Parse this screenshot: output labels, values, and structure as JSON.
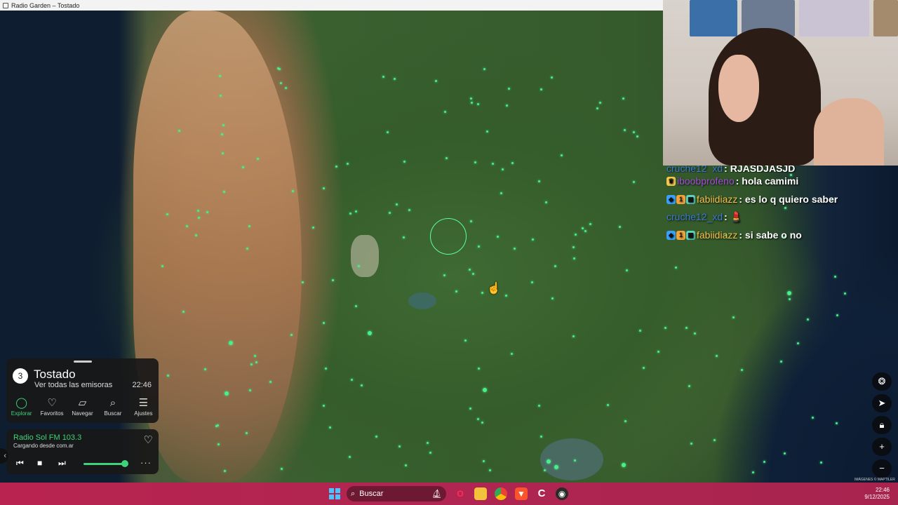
{
  "window": {
    "title": "Radio Garden – Tostado"
  },
  "chat": [
    {
      "user": "cruche12_xd",
      "message": ": RJASDJASJD",
      "user_color": "#3a7bd5",
      "badges": [],
      "cut": true
    },
    {
      "user": "iboobprofeno",
      "message": ": hola camimi",
      "user_color": "#a34bd9",
      "badges": [
        "crown"
      ]
    },
    {
      "user": "fabiidiazz",
      "message": ": es lo q quiero saber",
      "user_color": "#f5c24c",
      "badges": [
        "cube",
        "one",
        "grid"
      ]
    },
    {
      "user": "cruche12_xd",
      "message": ": 💄",
      "user_color": "#3a7bd5",
      "badges": []
    },
    {
      "user": "fabiidiazz",
      "message": ": si sabe o no",
      "user_color": "#f5c24c",
      "badges": [
        "cube",
        "one",
        "grid"
      ]
    }
  ],
  "panel": {
    "station_count": "3",
    "place": "Tostado",
    "all_stations_link": "Ver todas las emisoras",
    "local_time": "22:46",
    "nav": [
      {
        "label": "Explorar",
        "icon": "explore-icon",
        "active": true
      },
      {
        "label": "Favoritos",
        "icon": "heart-icon",
        "active": false
      },
      {
        "label": "Navegar",
        "icon": "map-icon",
        "active": false
      },
      {
        "label": "Buscar",
        "icon": "search-icon",
        "active": false
      },
      {
        "label": "Ajustes",
        "icon": "menu-icon",
        "active": false
      }
    ]
  },
  "player": {
    "station": "Radio Sol FM 103.3",
    "status": "Cargando desde com.ar",
    "volume_fraction": 0.95
  },
  "map": {
    "attribution": "IMÁGENES © MAPTILER",
    "controls": [
      "compass-icon",
      "locate-icon",
      "lock-icon",
      "zoom-in-icon",
      "zoom-out-icon"
    ]
  },
  "taskbar": {
    "search_placeholder": "Buscar",
    "time": "22:46",
    "date": "9/12/2025",
    "apps": [
      "opera-icon",
      "folder-icon",
      "chrome-icon",
      "brave-icon",
      "ccleaner-icon",
      "obs-icon"
    ]
  },
  "colors": {
    "accent": "#3ed37a",
    "station_dot": "#47f08a",
    "taskbar": "#b02552"
  }
}
